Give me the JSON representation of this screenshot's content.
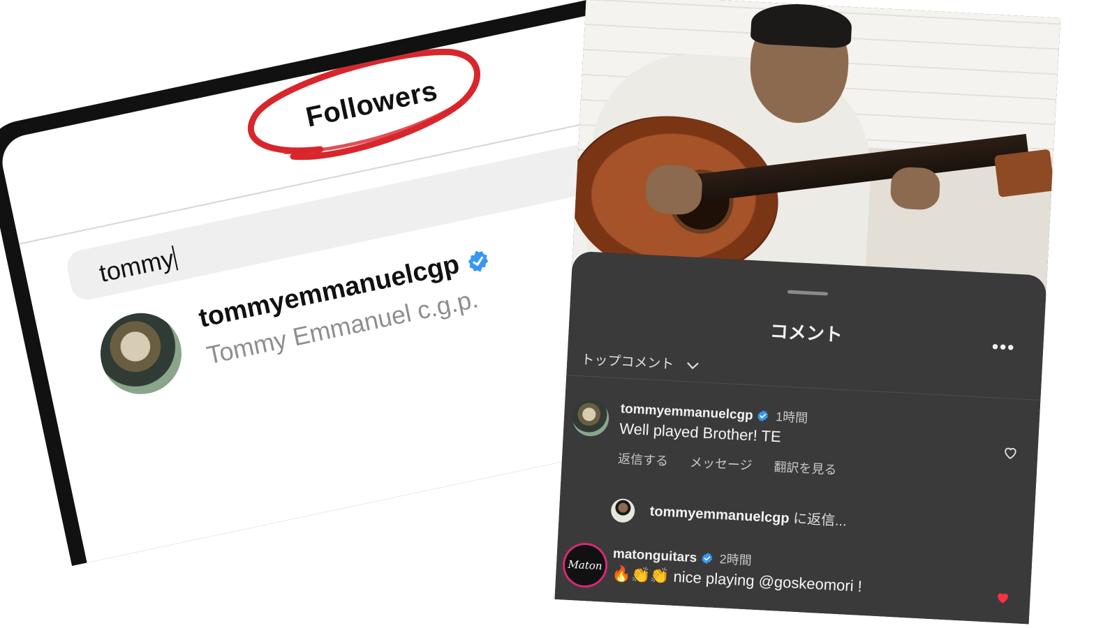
{
  "followers_panel": {
    "title": "Followers",
    "search": {
      "value": "tommy"
    },
    "result": {
      "username": "tommyemmanuelcgp",
      "full_name": "Tommy Emmanuel c.g.p."
    }
  },
  "comments_panel": {
    "title": "コメント",
    "more_label": "•••",
    "sort_label": "トップコメント",
    "comments": [
      {
        "username": "tommyemmanuelcgp",
        "time": "1時間",
        "text": "Well played Brother! TE",
        "actions": [
          "返信する",
          "メッセージ",
          "翻訳を見る"
        ]
      },
      {
        "username": "matonguitars",
        "time": "2時間",
        "emojis": "🔥👏👏",
        "text": "nice playing @goskeomori !",
        "avatar_text": "Maton",
        "liked": true
      }
    ],
    "reply_prompt": {
      "username": "tommyemmanuelcgp",
      "suffix": "に返信..."
    }
  },
  "colors": {
    "verified_blue": "#3897f0",
    "red_annotation": "#d8262c",
    "like_red": "#ff3040",
    "sheet_bg": "#3a3a3a"
  },
  "icons": [
    "verified-badge-icon",
    "chevron-down-icon",
    "more-icon",
    "heart-outline-icon",
    "heart-filled-icon"
  ]
}
